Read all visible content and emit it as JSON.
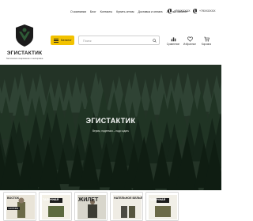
{
  "topnav": {
    "links": [
      {
        "label": "О компании"
      },
      {
        "label": "Блог"
      },
      {
        "label": "Контакты"
      },
      {
        "label": "Купить оптом"
      },
      {
        "label": "Доставка и оплата"
      },
      {
        "label": "Личный кабинет"
      }
    ],
    "phones": [
      {
        "number": "+79XXXXXX"
      },
      {
        "number": "+79XXXXXX"
      }
    ]
  },
  "header": {
    "brand": "ЭГИСТАКТИК",
    "tagline": "Тактическое снаряжение и экипировка",
    "catalog_label": "Каталог",
    "search_placeholder": "Поиск",
    "actions": [
      {
        "label": "Сравнение",
        "icon": "bar-chart-icon"
      },
      {
        "label": "Избранное",
        "icon": "heart-icon"
      },
      {
        "label": "Корзина",
        "icon": "cart-icon"
      }
    ]
  },
  "hero": {
    "title": "ЭГИСТАКТИК",
    "subtitle": "Верим, надеемся – надо ждать"
  },
  "cards": [
    {
      "caption": "ВОСТОК",
      "strip": "НАЛИЧИЕ",
      "bg": "#e9e4d8"
    },
    {
      "caption": "ТАЛОЧНАЯ",
      "strip": "",
      "bg": "#f3f0e6"
    },
    {
      "caption": "ЖИЛЕТ",
      "strip": "",
      "bg": "#d8d6cc"
    },
    {
      "caption": "НАТЕЛЬНОЕ БЕЛЬЁ",
      "strip": "",
      "bg": "#efece4"
    },
    {
      "caption": "ТАЛОЧНАЯ",
      "strip": "",
      "bg": "#f1efe7"
    }
  ],
  "colors": {
    "accent": "#f2c200",
    "forest": "#1f3224",
    "text": "#1b1b1b"
  }
}
